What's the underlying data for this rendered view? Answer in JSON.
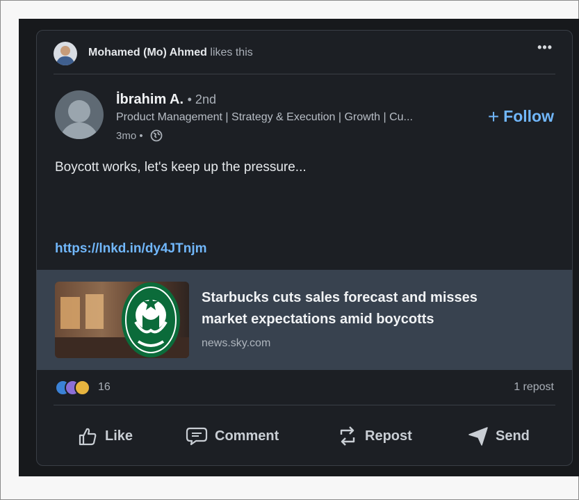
{
  "post": {
    "activity_actor": "Mohamed (Mo) Ahmed",
    "activity_verb": "likes this",
    "more_icon": "•••",
    "author": {
      "name": "İbrahim A.",
      "degree": "• 2nd",
      "headline": "Product Management | Strategy & Execution | Growth | Cu...",
      "time": "3mo •"
    },
    "follow_label": "Follow",
    "text": "Boycott works, let's keep up the pressure...",
    "link": "https://lnkd.in/dy4JTnjm",
    "preview": {
      "title_line1": "Starbucks cuts sales forecast and misses",
      "title_line2": "market expectations amid boycotts",
      "source": "news.sky.com"
    },
    "reactions": {
      "count": "16",
      "reposts": "1 repost",
      "icons": [
        "like-reaction-icon",
        "support-reaction-icon",
        "insightful-reaction-icon"
      ]
    },
    "actions": {
      "like": "Like",
      "comment": "Comment",
      "repost": "Repost",
      "send": "Send"
    }
  },
  "colors": {
    "card_bg": "#1c1f24",
    "link": "#71b7fb",
    "preview_bg": "#38424f"
  }
}
